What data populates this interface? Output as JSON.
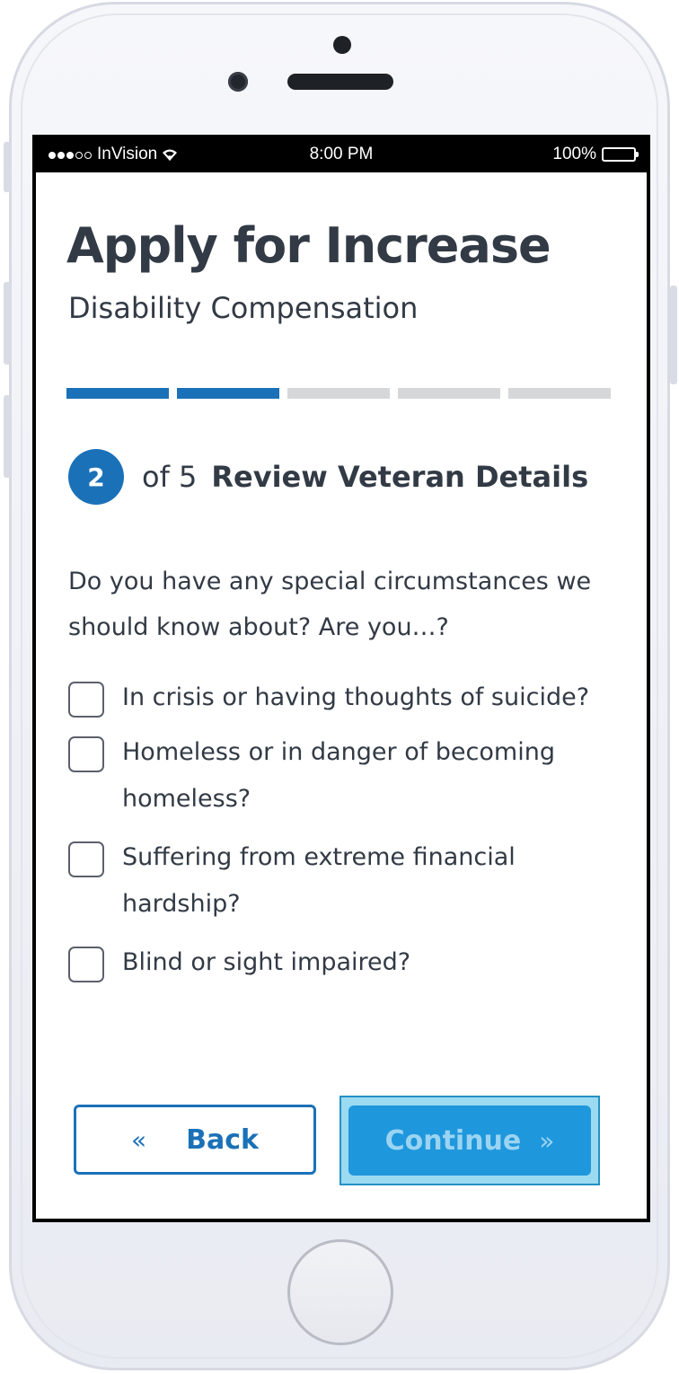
{
  "status_bar": {
    "carrier": "InVision",
    "time": "8:00 PM",
    "battery": "100%"
  },
  "header": {
    "title": "Apply for Increase",
    "subtitle": "Disability Compensation"
  },
  "progress": {
    "total_steps": 5,
    "completed_segments": 2
  },
  "step": {
    "number": "2",
    "of_text": "of 5",
    "title": "Review Veteran Details"
  },
  "question": "Do you have any special circumstances we should know about? Are you…?",
  "options": [
    {
      "label": "In crisis or having thoughts of suicide?",
      "checked": false
    },
    {
      "label": "Homeless or in danger of becoming homeless?",
      "checked": false
    },
    {
      "label": "Suffering from extreme financial hardship?",
      "checked": false
    },
    {
      "label": "Blind or sight impaired?",
      "checked": false
    }
  ],
  "buttons": {
    "back_icon": "«",
    "back_label": "Back",
    "continue_label": "Continue",
    "continue_icon": "»"
  },
  "colors": {
    "primary": "#1b71b8",
    "text": "#323a45",
    "progress_inactive": "#d6d7d9",
    "continue_bg": "#1f97dc",
    "focus_highlight": "#9bdaf1"
  }
}
